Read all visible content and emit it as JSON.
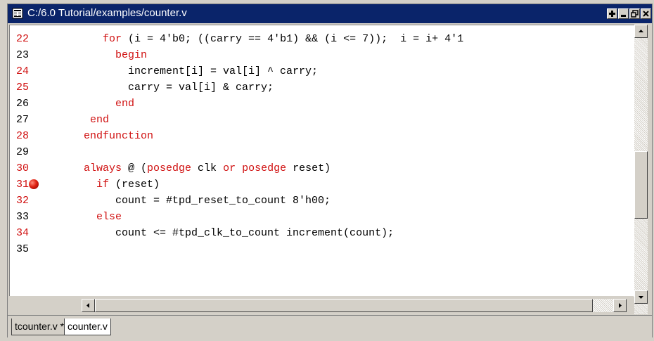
{
  "window": {
    "title": "C:/6.0 Tutorial/examples/counter.v"
  },
  "editor": {
    "lines": [
      {
        "num": "22",
        "num_color": "red",
        "segments": [
          {
            "t": "   "
          },
          {
            "t": "for",
            "kw": true
          },
          {
            "t": " (i = 4'b0; ((carry == 4'b1) && (i <= 7));  i = i+ 4'1"
          }
        ]
      },
      {
        "num": "23",
        "num_color": "black",
        "segments": [
          {
            "t": "     "
          },
          {
            "t": "begin",
            "kw": true
          }
        ]
      },
      {
        "num": "24",
        "num_color": "red",
        "segments": [
          {
            "t": "       increment[i] = val[i] ^ carry;"
          }
        ]
      },
      {
        "num": "25",
        "num_color": "red",
        "segments": [
          {
            "t": "       carry = val[i] & carry;"
          }
        ]
      },
      {
        "num": "26",
        "num_color": "black",
        "segments": [
          {
            "t": "     "
          },
          {
            "t": "end",
            "kw": true
          }
        ]
      },
      {
        "num": "27",
        "num_color": "black",
        "segments": [
          {
            "t": " "
          },
          {
            "t": "end",
            "kw": true
          }
        ]
      },
      {
        "num": "28",
        "num_color": "red",
        "segments": [
          {
            "t": "endfunction",
            "kw": true
          }
        ]
      },
      {
        "num": "29",
        "num_color": "black",
        "segments": []
      },
      {
        "num": "30",
        "num_color": "red",
        "segments": [
          {
            "t": "always",
            "kw": true
          },
          {
            "t": " @ ("
          },
          {
            "t": "posedge",
            "kw": true
          },
          {
            "t": " clk "
          },
          {
            "t": "or",
            "kw": true
          },
          {
            "t": " "
          },
          {
            "t": "posedge",
            "kw": true
          },
          {
            "t": " reset)"
          }
        ]
      },
      {
        "num": "31",
        "num_color": "red",
        "breakpoint": true,
        "segments": [
          {
            "t": "  "
          },
          {
            "t": "if",
            "kw": true
          },
          {
            "t": " (reset)"
          }
        ]
      },
      {
        "num": "32",
        "num_color": "red",
        "segments": [
          {
            "t": "     count = #tpd_reset_to_count 8'h00;"
          }
        ]
      },
      {
        "num": "33",
        "num_color": "black",
        "segments": [
          {
            "t": "  "
          },
          {
            "t": "else",
            "kw": true
          }
        ]
      },
      {
        "num": "34",
        "num_color": "red",
        "segments": [
          {
            "t": "     count <= #tpd_clk_to_count increment(count);"
          }
        ]
      },
      {
        "num": "35",
        "num_color": "black",
        "segments": []
      }
    ]
  },
  "tabs": [
    {
      "label": "tcounter.v *",
      "active": false
    },
    {
      "label": "counter.v",
      "active": true
    }
  ],
  "colors": {
    "title_bg": "#0a246a",
    "keyword": "#d01010",
    "breakpoint": "#e02010"
  },
  "icons": [
    "document-icon",
    "maximize-plus-icon",
    "minimize-icon",
    "restore-icon",
    "close-icon",
    "breakpoint-icon",
    "scroll-up-icon",
    "scroll-down-icon",
    "scroll-left-icon",
    "scroll-right-icon"
  ]
}
